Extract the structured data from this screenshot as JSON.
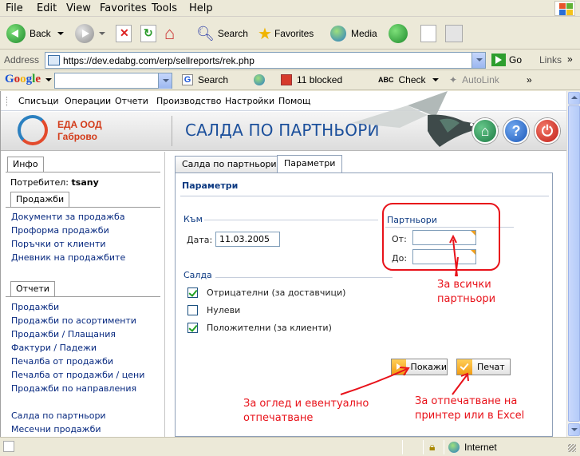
{
  "browser": {
    "menu": [
      "File",
      "Edit",
      "View",
      "Favorites",
      "Tools",
      "Help"
    ],
    "toolbar": {
      "back": "Back",
      "search": "Search",
      "favorites": "Favorites",
      "media": "Media"
    },
    "address": {
      "label": "Address",
      "url": "https://dev.edabg.com/erp/sellreports/rek.php",
      "go": "Go",
      "links": "Links"
    },
    "google": {
      "logo": "Google",
      "search": "Search",
      "blocked": "11 blocked",
      "check": "Check",
      "autolink": "AutoLink"
    },
    "status": {
      "zone": "Internet"
    }
  },
  "app": {
    "menu": [
      "Списъци",
      "Операции",
      "Отчети",
      "Производство",
      "Настройки",
      "Помощ"
    ],
    "company": {
      "name": "ЕДА ООД",
      "city": "Габрово"
    },
    "page_title": "САЛДА ПО ПАРТНЬОРИ",
    "header_buttons": {
      "home": "home-icon",
      "help": "?",
      "power": "power-icon"
    },
    "left": {
      "info_tab": "Инфо",
      "user_label": "Потребител:",
      "user_name": "tsany",
      "sales_tab": "Продажби",
      "sales_links": [
        "Документи за продажба",
        "Проформа продажби",
        "Поръчки от клиенти",
        "Дневник на продажбите"
      ],
      "reports_tab": "Отчети",
      "reports_links": [
        "Продажби",
        "Продажби по асортименти",
        "Продажби / Плащания",
        "Фактури / Падежи",
        "Печалба от продажби",
        "Печалба от продажби / цени",
        "Продажби по направления"
      ],
      "reports_links_2": [
        "Салда по партньори",
        "Месечни продажби"
      ]
    },
    "tabs": [
      "Салда по партньори",
      "Параметри"
    ],
    "params": {
      "title": "Параметри",
      "to_group": "Към",
      "date_label": "Дата:",
      "date_value": "11.03.2005",
      "partners_group": "Партньори",
      "from_label": "От:",
      "from_value": "",
      "until_label": "До:",
      "until_value": "",
      "salda_group": "Салда",
      "options": [
        {
          "label": "Отрицателни (за доставчици)",
          "checked": true
        },
        {
          "label": "Нулеви",
          "checked": false
        },
        {
          "label": "Положителни (за клиенти)",
          "checked": true
        }
      ],
      "show_button": "Покажи",
      "print_button": "Печат"
    },
    "annotations": {
      "all_partners": [
        "За всички",
        "партньори"
      ],
      "view": [
        "За оглед и евентуално",
        "отпечатване"
      ],
      "print": [
        "За отпечатване на",
        "принтер или в Excel"
      ]
    },
    "colors": {
      "annotation": "#e8121a",
      "title": "#1b4f9b",
      "company": "#d33c1b",
      "link": "#06287f"
    }
  }
}
